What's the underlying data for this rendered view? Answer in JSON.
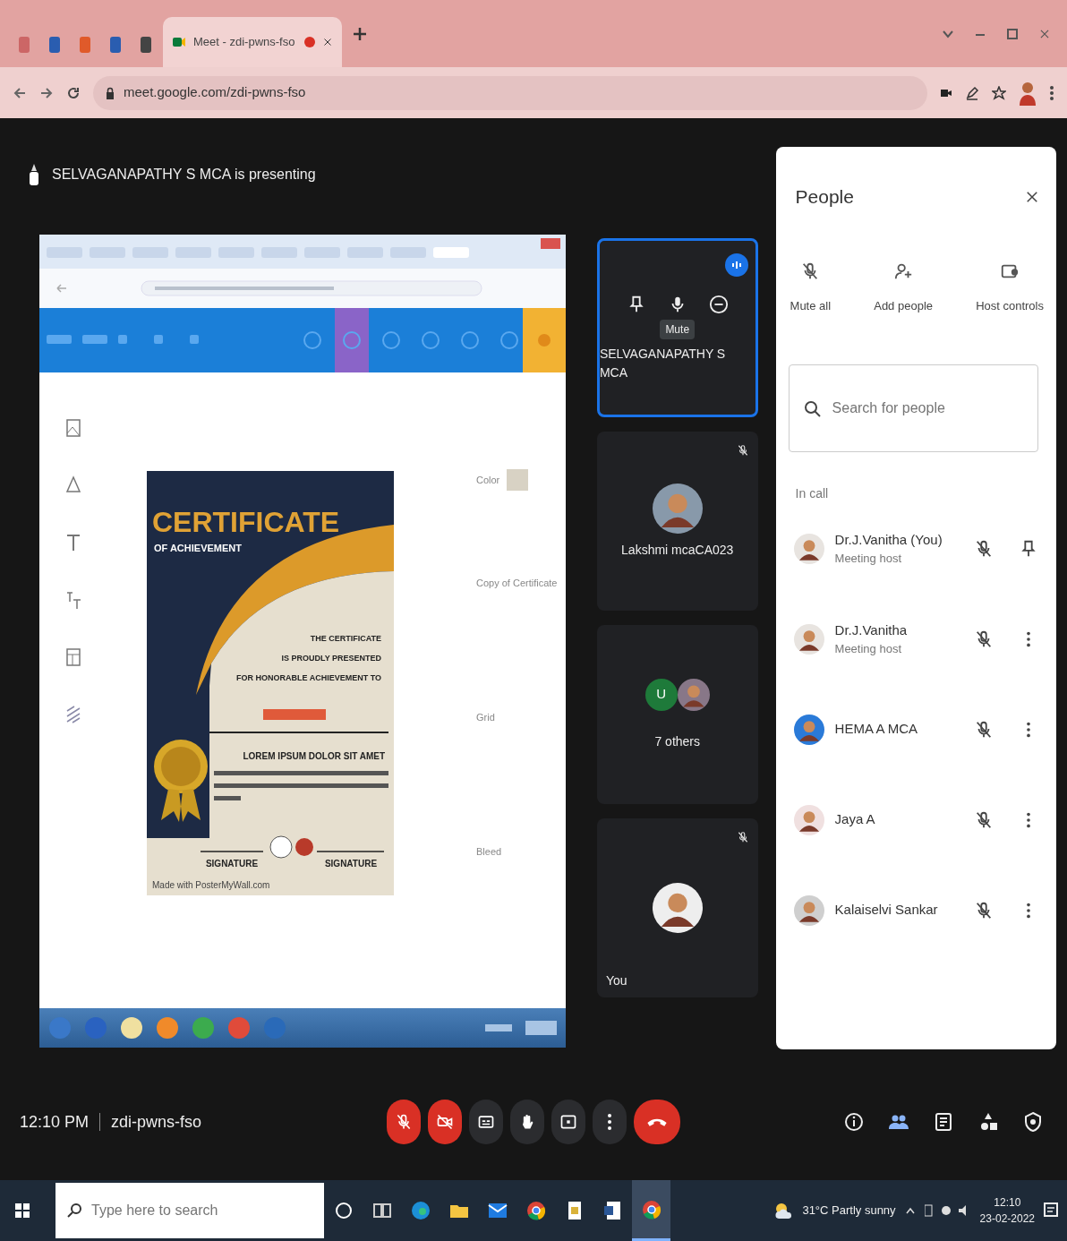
{
  "browser": {
    "tabs": [
      {
        "kind": "pinned",
        "selected": false
      },
      {
        "kind": "pinned",
        "selected": false
      },
      {
        "kind": "pinned",
        "selected": false
      },
      {
        "kind": "pinned",
        "selected": false
      },
      {
        "kind": "pinned",
        "selected": false
      },
      {
        "kind": "page",
        "title": "Meet - zdi-pwns-fso",
        "recording": true,
        "selected": true
      }
    ],
    "url": "meet.google.com/zdi-pwns-fso"
  },
  "presenting": "SELVAGANAPATHY S MCA is presenting",
  "shared_screen": {
    "certificate": {
      "title": "CERTIFICATE",
      "subtitle": "OF ACHIEVEMENT",
      "presented": [
        "THE CERTIFICATE",
        "IS PROUDLY PRESENTED",
        "FOR HONORABLE ACHIEVEMENT TO"
      ],
      "heading": "LOREM IPSUM DOLOR SIT AMET",
      "signatures": [
        "SIGNATURE",
        "SIGNATURE"
      ],
      "credit": "Made with PosterMyWall.com"
    },
    "properties": [
      "Color",
      "Copy of Certificate",
      "Grid",
      "Bleed"
    ]
  },
  "tiles": [
    {
      "kind": "hover",
      "name": "SELVAGANAPATHY S MCA",
      "tooltip": "Mute",
      "speaking": true,
      "muted": false,
      "selected": true
    },
    {
      "kind": "person",
      "name": "Lakshmi mcaCA023",
      "speaking": false,
      "muted": true,
      "selected": false
    },
    {
      "kind": "group",
      "letter": "U",
      "name": "7 others",
      "speaking": false,
      "muted": false,
      "selected": false
    },
    {
      "kind": "self",
      "name": "You",
      "speaking": false,
      "muted": true,
      "selected": false
    }
  ],
  "people_panel": {
    "title": "People",
    "actions": [
      {
        "kind": "mute",
        "label": "Mute all"
      },
      {
        "kind": "add",
        "label": "Add people"
      },
      {
        "kind": "host",
        "label": "Host controls"
      }
    ],
    "search": {
      "placeholder": "Search for people"
    },
    "section": "In call",
    "people": [
      {
        "kind": "self",
        "name": "Dr.J.Vanitha (You)",
        "role": "Meeting host",
        "muted": true
      },
      {
        "kind": "other",
        "name": "Dr.J.Vanitha",
        "role": "Meeting host",
        "muted": true
      },
      {
        "kind": "other",
        "name": "HEMA A MCA",
        "muted": true
      },
      {
        "kind": "other",
        "name": "Jaya A",
        "muted": true
      },
      {
        "kind": "other",
        "name": "Kalaiselvi Sankar",
        "muted": true
      }
    ]
  },
  "call_bar": {
    "time": "12:10 PM",
    "code": "zdi-pwns-fso",
    "controls": [
      {
        "kind": "mic",
        "on": false
      },
      {
        "kind": "camera",
        "on": false
      },
      {
        "kind": "captions",
        "on": false
      },
      {
        "kind": "hand",
        "on": false
      },
      {
        "kind": "present",
        "on": false
      },
      {
        "kind": "more",
        "on": false
      },
      {
        "kind": "leave",
        "on": false
      }
    ],
    "side": [
      {
        "kind": "info",
        "selected": false
      },
      {
        "kind": "people",
        "selected": true
      },
      {
        "kind": "chat",
        "selected": false
      },
      {
        "kind": "activities",
        "selected": false
      },
      {
        "kind": "host",
        "selected": false
      }
    ]
  },
  "taskbar": {
    "search": {
      "placeholder": "Type here to search"
    },
    "apps": [
      {
        "kind": "cortana",
        "selected": false
      },
      {
        "kind": "taskview",
        "selected": false
      },
      {
        "kind": "edge",
        "selected": false
      },
      {
        "kind": "folder",
        "selected": false
      },
      {
        "kind": "mail",
        "selected": false
      },
      {
        "kind": "chrome",
        "selected": false
      },
      {
        "kind": "notepad",
        "selected": false
      },
      {
        "kind": "word",
        "selected": false
      },
      {
        "kind": "chrome",
        "selected": true
      }
    ],
    "weather": "31°C  Partly sunny",
    "time": "12:10",
    "date": "23-02-2022"
  }
}
